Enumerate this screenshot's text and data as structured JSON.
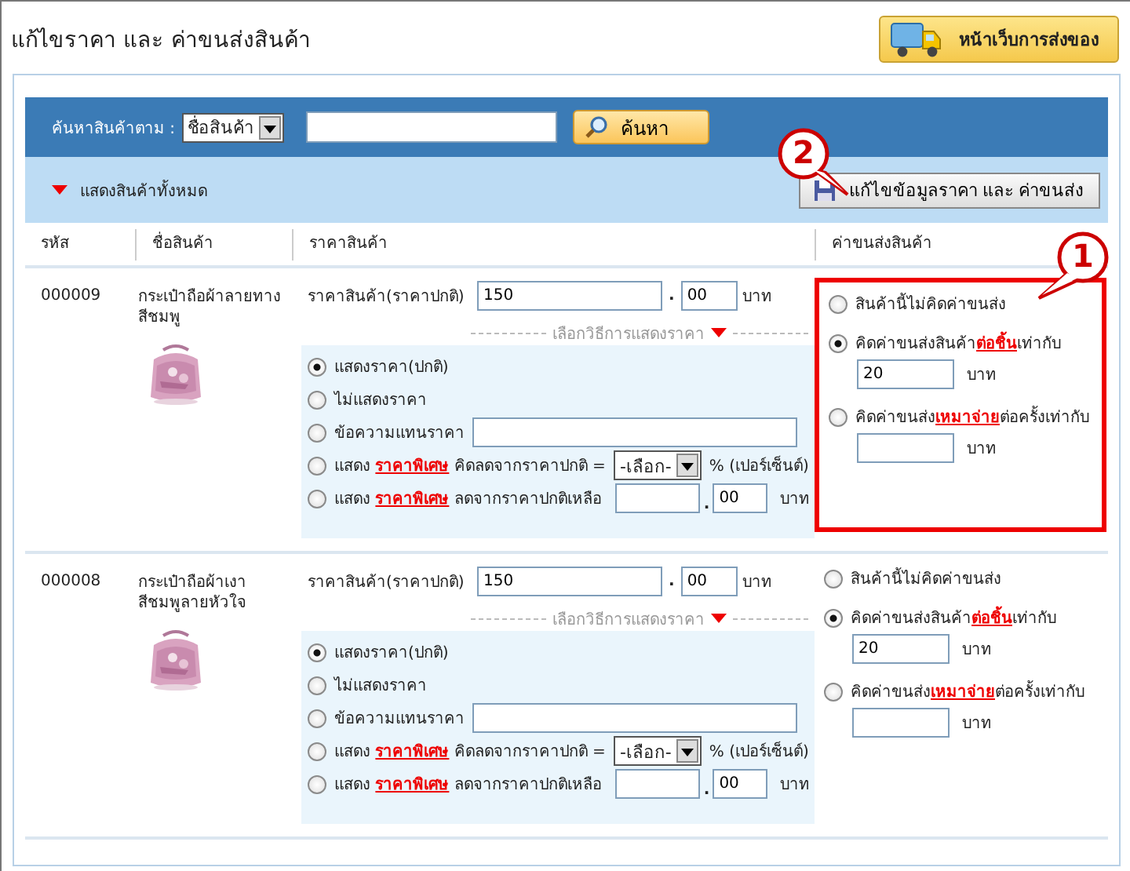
{
  "page": {
    "title": "แก้ไขราคา และ ค่าขนส่งสินค้า",
    "shipping_page_button": "หน้าเว็บการส่งของ"
  },
  "search": {
    "label": "ค้นหาสินค้าตาม :",
    "field_select": "ชื่อสินค้า",
    "button": "ค้นหา"
  },
  "toolbar": {
    "show_all": "แสดงสินค้าทั้งหมด",
    "save_button": "แก้ไขข้อมูลราคา และ ค่าขนส่ง",
    "callout": "2"
  },
  "columns": [
    "รหัส",
    "ชื่อสินค้า",
    "ราคาสินค้า",
    "ค่าขนส่งสินค้า"
  ],
  "products": [
    {
      "code": "000009",
      "name": "กระเป๋าถือผ้าลายทางสีชมพู",
      "price_label": "ราคาสินค้า(ราคาปกติ)",
      "price": "150",
      "decimal_point": ".",
      "decimals": "00",
      "currency": "บาท",
      "display_heading": "เลือกวิธีการแสดงราคา",
      "price_options": [
        {
          "kind": "plain",
          "selected": true,
          "label": "แสดงราคา(ปกติ)"
        },
        {
          "kind": "plain",
          "selected": false,
          "label": "ไม่แสดงราคา"
        },
        {
          "kind": "text",
          "selected": false,
          "label": "ข้อความแทนราคา"
        },
        {
          "kind": "percent",
          "selected": false,
          "prefix": "แสดง",
          "link": "ราคาพิเศษ",
          "suffix": "คิดลดจากราคาปกติ =",
          "select": "-เลือก-",
          "unit": "% (เปอร์เซ็นต์)"
        },
        {
          "kind": "amount",
          "selected": false,
          "prefix": "แสดง",
          "link": "ราคาพิเศษ",
          "suffix": "ลดจากราคาปกติเหลือ",
          "decimals": "00",
          "unit": "บาท"
        }
      ],
      "shipping": {
        "highlighted": true,
        "callout": "1",
        "options": [
          {
            "kind": "none",
            "selected": false,
            "label": "สินค้านี้ไม่คิดค่าขนส่ง"
          },
          {
            "kind": "rate",
            "selected": true,
            "prefix": "คิดค่าขนส่งสินค้า",
            "link": "ต่อชิ้น",
            "suffix": "เท่ากับ",
            "value": "20",
            "unit": "บาท"
          },
          {
            "kind": "rate",
            "selected": false,
            "prefix": "คิดค่าขนส่ง",
            "link": "เหมาจ่าย",
            "suffix": "ต่อครั้งเท่ากับ",
            "unit": "บาท"
          }
        ]
      }
    },
    {
      "code": "000008",
      "name": "กระเป๋าถือผ้าเงาสีชมพูลายหัวใจ",
      "price_label": "ราคาสินค้า(ราคาปกติ)",
      "price": "150",
      "decimal_point": ".",
      "decimals": "00",
      "currency": "บาท",
      "display_heading": "เลือกวิธีการแสดงราคา",
      "price_options": [
        {
          "kind": "plain",
          "selected": true,
          "label": "แสดงราคา(ปกติ)"
        },
        {
          "kind": "plain",
          "selected": false,
          "label": "ไม่แสดงราคา"
        },
        {
          "kind": "text",
          "selected": false,
          "label": "ข้อความแทนราคา"
        },
        {
          "kind": "percent",
          "selected": false,
          "prefix": "แสดง",
          "link": "ราคาพิเศษ",
          "suffix": "คิดลดจากราคาปกติ =",
          "select": "-เลือก-",
          "unit": "% (เปอร์เซ็นต์)"
        },
        {
          "kind": "amount",
          "selected": false,
          "prefix": "แสดง",
          "link": "ราคาพิเศษ",
          "suffix": "ลดจากราคาปกติเหลือ",
          "decimals": "00",
          "unit": "บาท"
        }
      ],
      "shipping": {
        "highlighted": false,
        "options": [
          {
            "kind": "none",
            "selected": false,
            "label": "สินค้านี้ไม่คิดค่าขนส่ง"
          },
          {
            "kind": "rate",
            "selected": true,
            "prefix": "คิดค่าขนส่งสินค้า",
            "link": "ต่อชิ้น",
            "suffix": "เท่ากับ",
            "value": "20",
            "unit": "บาท"
          },
          {
            "kind": "rate",
            "selected": false,
            "prefix": "คิดค่าขนส่ง",
            "link": "เหมาจ่าย",
            "suffix": "ต่อครั้งเท่ากับ",
            "unit": "บาท"
          }
        ]
      }
    }
  ]
}
